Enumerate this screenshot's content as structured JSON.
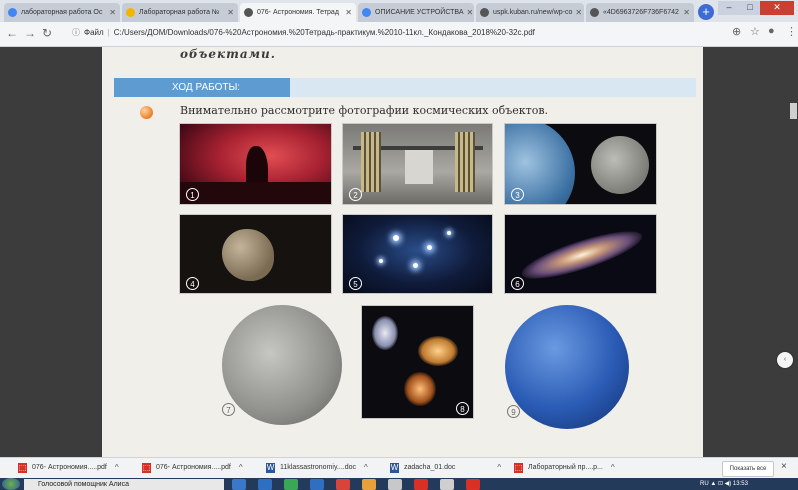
{
  "browser": {
    "tabs": [
      {
        "label": "лабораторная работа Ос",
        "active": false,
        "icon": "google-icon",
        "color": "#4285f4"
      },
      {
        "label": "Лабораторная работа №",
        "active": false,
        "icon": "page-icon",
        "color": "#f4b400"
      },
      {
        "label": "076- Астрономия. Тетрад",
        "active": true,
        "icon": "chrome-icon",
        "color": "#555555"
      },
      {
        "label": "ОПИСАНИЕ УСТРОЙСТВА",
        "active": false,
        "icon": "google-icon",
        "color": "#4285f4"
      },
      {
        "label": "uspk.kuban.ru/new/wp-co",
        "active": false,
        "icon": "chrome-icon",
        "color": "#555555"
      },
      {
        "label": "«4D6963726F736F6742",
        "active": false,
        "icon": "chrome-icon",
        "color": "#555555"
      }
    ],
    "new_tab": "+",
    "address": {
      "scheme_label": "Файл",
      "url": "C:/Users/ДОМ/Downloads/076-%20Астрономия.%20Тетрадь-практикум.%2010-11кл._Кондакова_2018%20-32c.pdf"
    }
  },
  "pdf": {
    "heading_tail": "объектами.",
    "section_label": "ХОД РАБОТЫ:",
    "instruction": "Внимательно рассмотрите фотографии космических объектов.",
    "photo_numbers": [
      "1",
      "2",
      "3",
      "4",
      "5",
      "6",
      "7",
      "8",
      "9"
    ]
  },
  "downloads": {
    "items": [
      {
        "name": "076- Астрономия.....pdf",
        "type": "pdf"
      },
      {
        "name": "076- Астрономия.....pdf",
        "type": "pdf"
      },
      {
        "name": "11klassastronomiy....doc",
        "type": "doc"
      },
      {
        "name": "zadacha_01.doc",
        "type": "doc"
      },
      {
        "name": "Лабораторный пр....р...",
        "type": "pdf"
      }
    ],
    "show_all": "Показать все",
    "close": "×"
  },
  "taskbar": {
    "search_text": "Голосовой помощник Алиса",
    "tray": "RU ▲ ⊡ ◀) 13:53"
  },
  "colors": {
    "accent": "#5d9bd1",
    "band": "#d9e7f2",
    "page": "#f1efea"
  }
}
